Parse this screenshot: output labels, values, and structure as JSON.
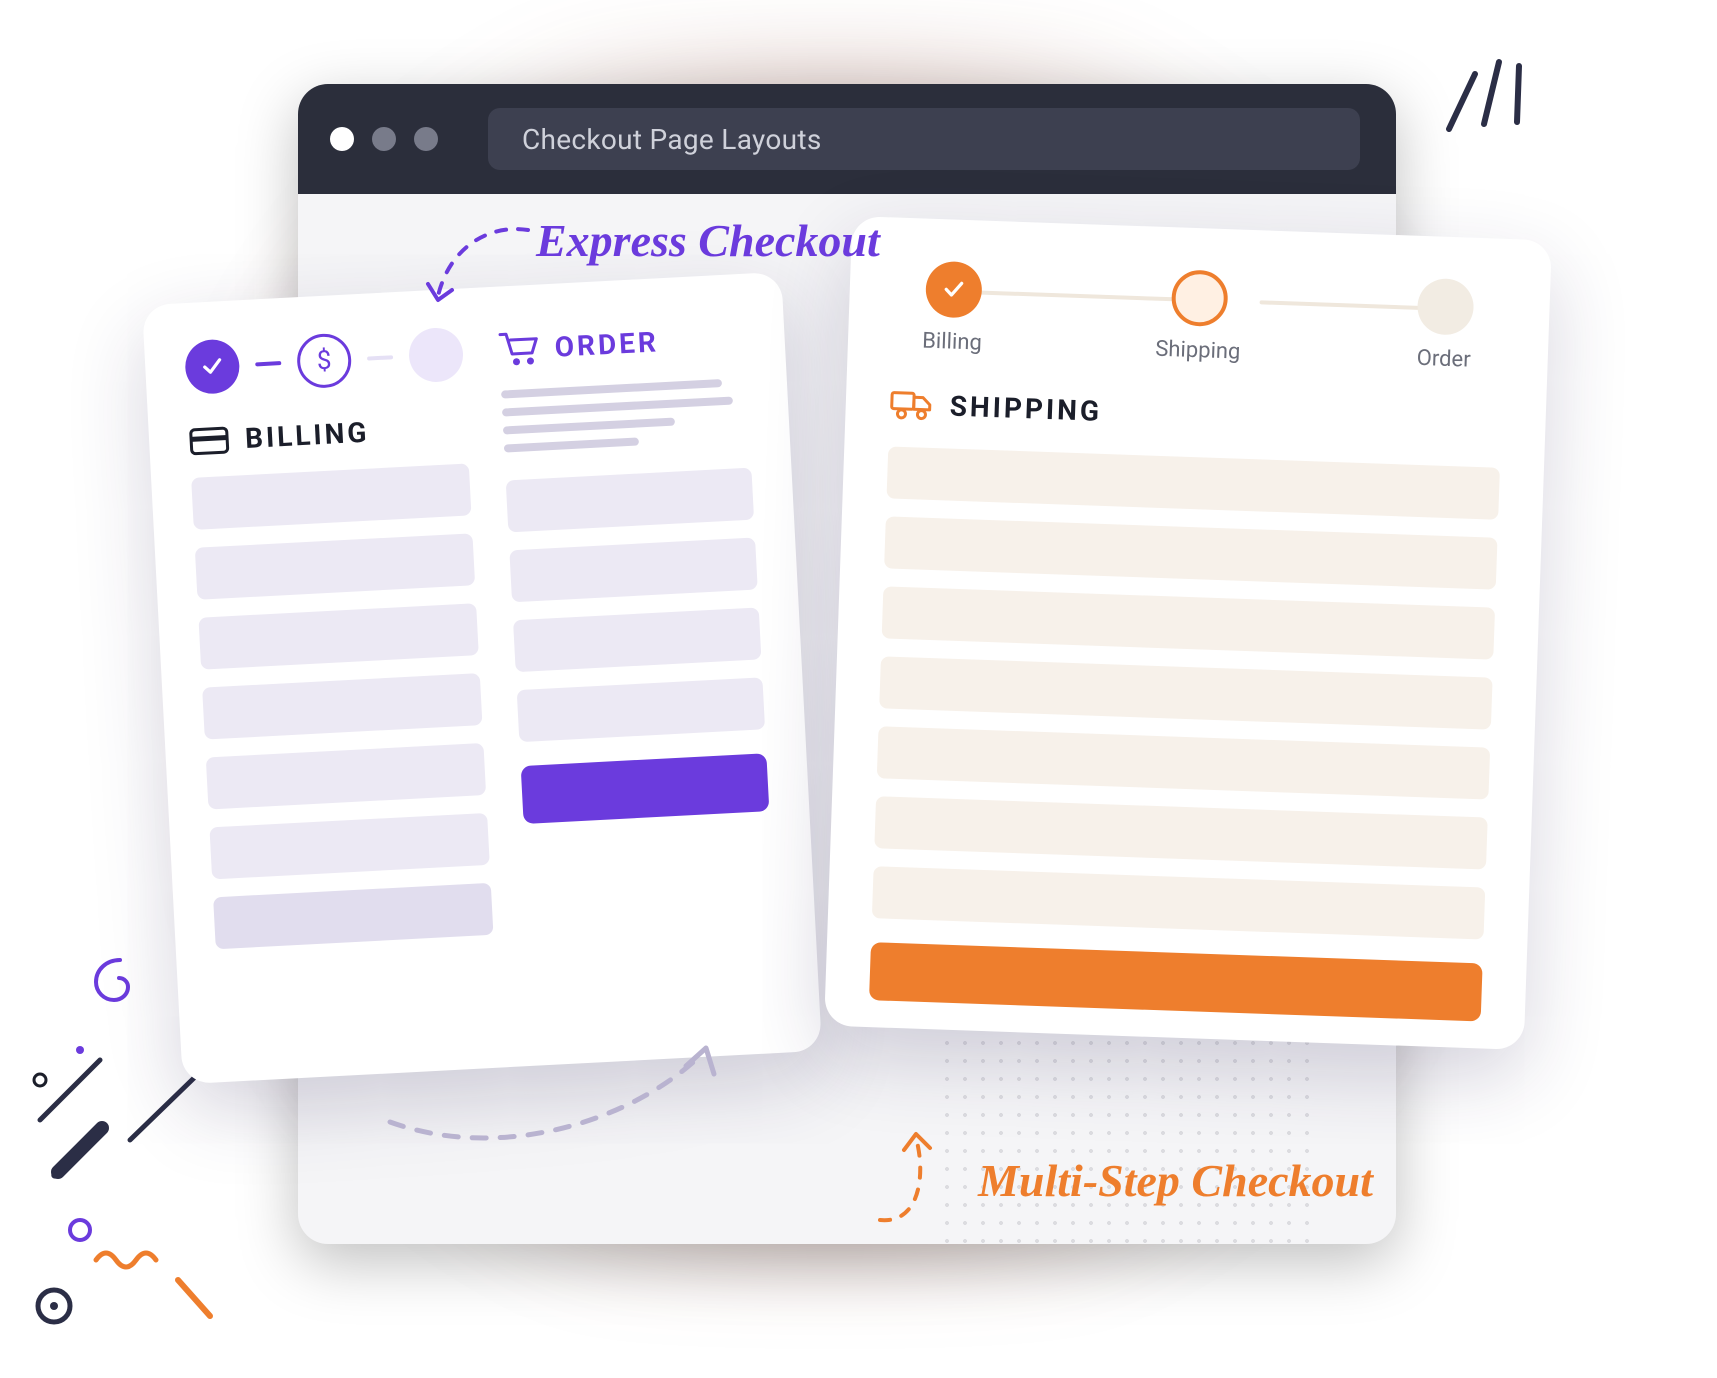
{
  "browser": {
    "title": "Checkout Page Layouts"
  },
  "labels": {
    "express": "Express Checkout",
    "multistep": "Multi-Step Checkout"
  },
  "express": {
    "billing_label": "BILLING",
    "order_label": "ORDER",
    "progress": {
      "step1_state": "done",
      "step2_icon": "$",
      "step3_state": "next"
    }
  },
  "multistep": {
    "steps": {
      "billing": "Billing",
      "shipping": "Shipping",
      "order": "Order"
    },
    "section_label": "SHIPPING"
  },
  "colors": {
    "purple": "#6b3bdd",
    "orange": "#ee7e2d",
    "titlebar": "#2b2e3b"
  }
}
